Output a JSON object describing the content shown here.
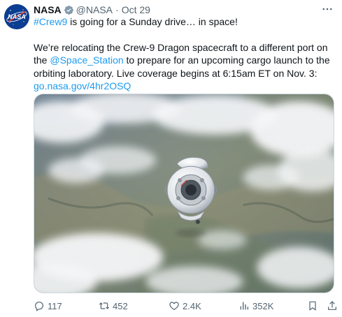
{
  "author": {
    "name": "NASA",
    "handle": "@NASA",
    "separator": "·",
    "date": "Oct 29",
    "avatar_text": "NASA",
    "verified_icon": "verified-badge-icon"
  },
  "tweet": {
    "line1_hashtag": "#Crew9",
    "line1_rest": " is going for a Sunday drive… in space!",
    "para2_start": "We’re relocating the Crew-9 Dragon spacecraft to a different port on the ",
    "para2_mention": "@Space_Station",
    "para2_end": " to prepare for an upcoming cargo launch to the orbiting laboratory. Live coverage begins at 6:15am ET on Nov. 3:",
    "link": "go.nasa.gov/4hr2OSQ"
  },
  "stats": {
    "replies": "117",
    "retweets": "452",
    "likes": "2.4K",
    "views": "352K"
  },
  "colors": {
    "link": "#1d9bf0",
    "secondary_text": "#536471",
    "primary_text": "#0f1419",
    "nasa_blue": "#0b3d91"
  }
}
